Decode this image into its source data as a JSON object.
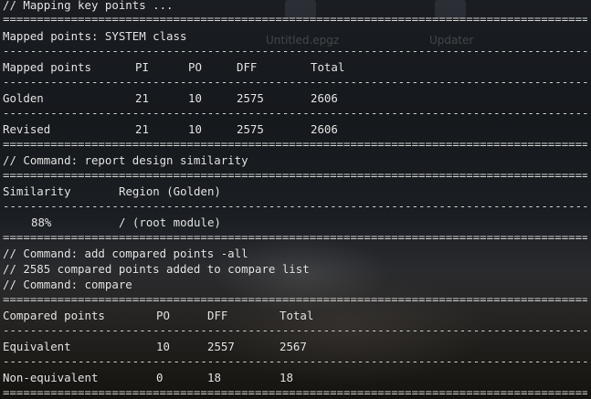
{
  "desktop": {
    "icons": [
      {
        "label": "Untitled.epgz"
      },
      {
        "label": "Updater"
      }
    ]
  },
  "terminal": {
    "mapping_comment": "// Mapping key points ...",
    "mapped_points_title": "Mapped points: SYSTEM class",
    "mapped_table": {
      "headers": [
        "Mapped points",
        "PI",
        "PO",
        "DFF",
        "Total"
      ],
      "rows": [
        [
          "Golden",
          "21",
          "10",
          "2575",
          "2606"
        ],
        [
          "Revised",
          "21",
          "10",
          "2575",
          "2606"
        ]
      ]
    },
    "similarity_command": "// Command: report design similarity",
    "similarity_table": {
      "headers": [
        "Similarity",
        "Region (Golden)"
      ],
      "rows": [
        [
          "88%",
          "/ (root module)"
        ]
      ]
    },
    "add_command": "// Command: add compared points -all",
    "add_result": "// 2585 compared points added to compare list",
    "compare_command": "// Command: compare",
    "compared_table": {
      "headers": [
        "Compared points",
        "PO",
        "DFF",
        "Total"
      ],
      "rows": [
        [
          "Equivalent",
          "10",
          "2557",
          "2567"
        ],
        [
          "Non-equivalent",
          "0",
          "18",
          "18"
        ]
      ]
    },
    "separator_double": "=======================================================================================================================",
    "separator_single": "-----------------------------------------------------------------------------------------------------------------------"
  }
}
